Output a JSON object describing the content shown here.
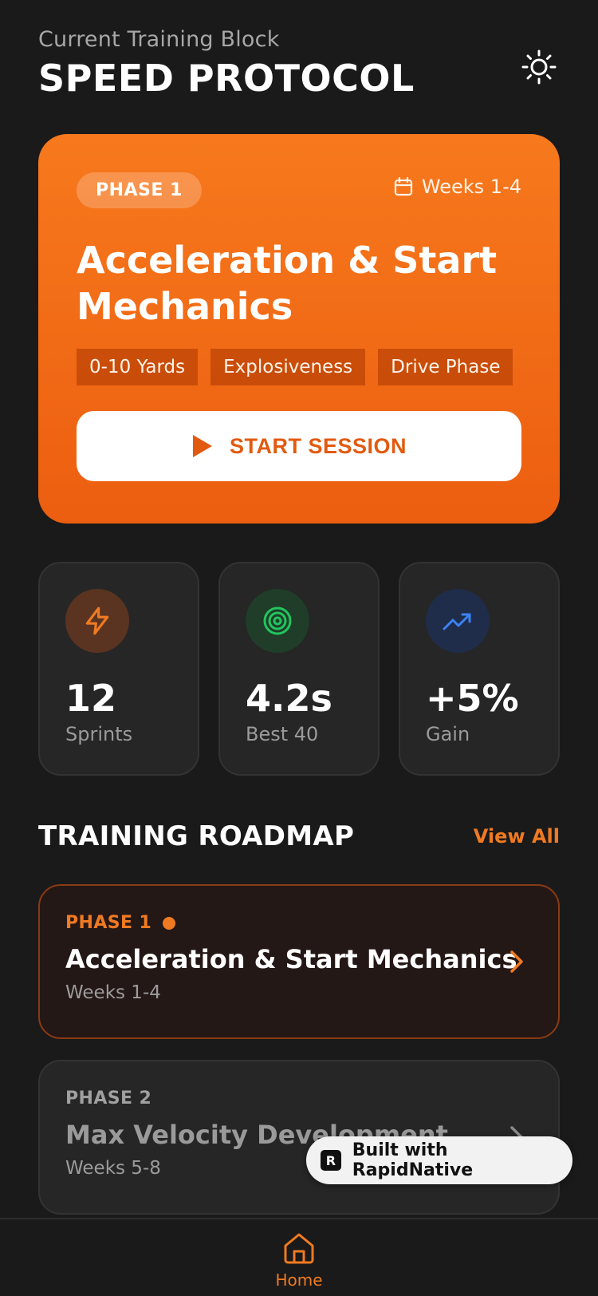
{
  "header": {
    "subtitle": "Current Training Block",
    "title": "SPEED PROTOCOL",
    "theme_icon": "sun-icon"
  },
  "hero": {
    "phase_label": "PHASE 1",
    "weeks": "Weeks 1-4",
    "title": "Acceleration & Start Mechanics",
    "tags": [
      "0-10 Yards",
      "Explosiveness",
      "Drive Phase"
    ],
    "start_label": "START SESSION",
    "colors": {
      "gradient_top": "#f7791d",
      "gradient_bottom": "#ec5e10"
    }
  },
  "stats": [
    {
      "icon": "lightning-icon",
      "value": "12",
      "label": "Sprints",
      "color": "#f07a22"
    },
    {
      "icon": "target-icon",
      "value": "4.2s",
      "label": "Best 40",
      "color": "#22c55e"
    },
    {
      "icon": "trending-up-icon",
      "value": "+5%",
      "label": "Gain",
      "color": "#3b82f6"
    }
  ],
  "roadmap": {
    "title": "TRAINING ROADMAP",
    "view_all": "View All",
    "phases": [
      {
        "label": "PHASE 1",
        "name": "Acceleration & Start Mechanics",
        "weeks": "Weeks 1-4",
        "active": true
      },
      {
        "label": "PHASE 2",
        "name": "Max Velocity Development",
        "weeks": "Weeks 5-8",
        "active": false
      }
    ]
  },
  "badge": {
    "text": "Built with RapidNative"
  },
  "nav": {
    "home_label": "Home"
  }
}
